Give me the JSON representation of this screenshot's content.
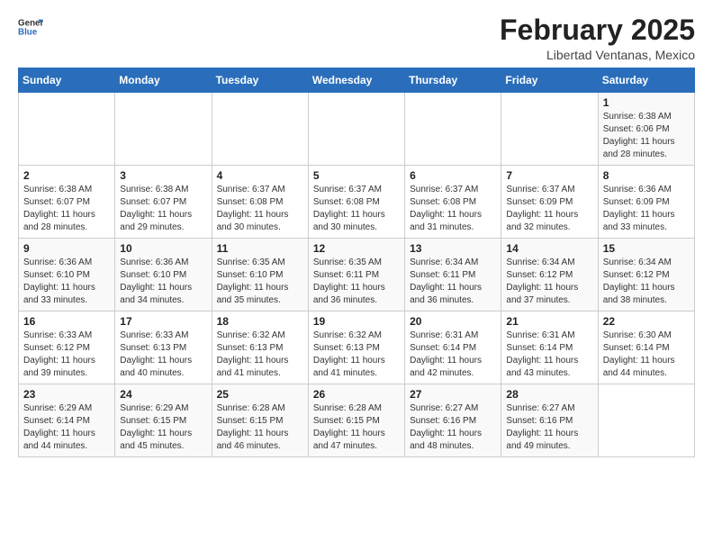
{
  "header": {
    "logo_general": "General",
    "logo_blue": "Blue",
    "month_title": "February 2025",
    "subtitle": "Libertad Ventanas, Mexico"
  },
  "days_of_week": [
    "Sunday",
    "Monday",
    "Tuesday",
    "Wednesday",
    "Thursday",
    "Friday",
    "Saturday"
  ],
  "weeks": [
    [
      {
        "day": "",
        "info": ""
      },
      {
        "day": "",
        "info": ""
      },
      {
        "day": "",
        "info": ""
      },
      {
        "day": "",
        "info": ""
      },
      {
        "day": "",
        "info": ""
      },
      {
        "day": "",
        "info": ""
      },
      {
        "day": "1",
        "info": "Sunrise: 6:38 AM\nSunset: 6:06 PM\nDaylight: 11 hours and 28 minutes."
      }
    ],
    [
      {
        "day": "2",
        "info": "Sunrise: 6:38 AM\nSunset: 6:07 PM\nDaylight: 11 hours and 28 minutes."
      },
      {
        "day": "3",
        "info": "Sunrise: 6:38 AM\nSunset: 6:07 PM\nDaylight: 11 hours and 29 minutes."
      },
      {
        "day": "4",
        "info": "Sunrise: 6:37 AM\nSunset: 6:08 PM\nDaylight: 11 hours and 30 minutes."
      },
      {
        "day": "5",
        "info": "Sunrise: 6:37 AM\nSunset: 6:08 PM\nDaylight: 11 hours and 30 minutes."
      },
      {
        "day": "6",
        "info": "Sunrise: 6:37 AM\nSunset: 6:08 PM\nDaylight: 11 hours and 31 minutes."
      },
      {
        "day": "7",
        "info": "Sunrise: 6:37 AM\nSunset: 6:09 PM\nDaylight: 11 hours and 32 minutes."
      },
      {
        "day": "8",
        "info": "Sunrise: 6:36 AM\nSunset: 6:09 PM\nDaylight: 11 hours and 33 minutes."
      }
    ],
    [
      {
        "day": "9",
        "info": "Sunrise: 6:36 AM\nSunset: 6:10 PM\nDaylight: 11 hours and 33 minutes."
      },
      {
        "day": "10",
        "info": "Sunrise: 6:36 AM\nSunset: 6:10 PM\nDaylight: 11 hours and 34 minutes."
      },
      {
        "day": "11",
        "info": "Sunrise: 6:35 AM\nSunset: 6:10 PM\nDaylight: 11 hours and 35 minutes."
      },
      {
        "day": "12",
        "info": "Sunrise: 6:35 AM\nSunset: 6:11 PM\nDaylight: 11 hours and 36 minutes."
      },
      {
        "day": "13",
        "info": "Sunrise: 6:34 AM\nSunset: 6:11 PM\nDaylight: 11 hours and 36 minutes."
      },
      {
        "day": "14",
        "info": "Sunrise: 6:34 AM\nSunset: 6:12 PM\nDaylight: 11 hours and 37 minutes."
      },
      {
        "day": "15",
        "info": "Sunrise: 6:34 AM\nSunset: 6:12 PM\nDaylight: 11 hours and 38 minutes."
      }
    ],
    [
      {
        "day": "16",
        "info": "Sunrise: 6:33 AM\nSunset: 6:12 PM\nDaylight: 11 hours and 39 minutes."
      },
      {
        "day": "17",
        "info": "Sunrise: 6:33 AM\nSunset: 6:13 PM\nDaylight: 11 hours and 40 minutes."
      },
      {
        "day": "18",
        "info": "Sunrise: 6:32 AM\nSunset: 6:13 PM\nDaylight: 11 hours and 41 minutes."
      },
      {
        "day": "19",
        "info": "Sunrise: 6:32 AM\nSunset: 6:13 PM\nDaylight: 11 hours and 41 minutes."
      },
      {
        "day": "20",
        "info": "Sunrise: 6:31 AM\nSunset: 6:14 PM\nDaylight: 11 hours and 42 minutes."
      },
      {
        "day": "21",
        "info": "Sunrise: 6:31 AM\nSunset: 6:14 PM\nDaylight: 11 hours and 43 minutes."
      },
      {
        "day": "22",
        "info": "Sunrise: 6:30 AM\nSunset: 6:14 PM\nDaylight: 11 hours and 44 minutes."
      }
    ],
    [
      {
        "day": "23",
        "info": "Sunrise: 6:29 AM\nSunset: 6:14 PM\nDaylight: 11 hours and 44 minutes."
      },
      {
        "day": "24",
        "info": "Sunrise: 6:29 AM\nSunset: 6:15 PM\nDaylight: 11 hours and 45 minutes."
      },
      {
        "day": "25",
        "info": "Sunrise: 6:28 AM\nSunset: 6:15 PM\nDaylight: 11 hours and 46 minutes."
      },
      {
        "day": "26",
        "info": "Sunrise: 6:28 AM\nSunset: 6:15 PM\nDaylight: 11 hours and 47 minutes."
      },
      {
        "day": "27",
        "info": "Sunrise: 6:27 AM\nSunset: 6:16 PM\nDaylight: 11 hours and 48 minutes."
      },
      {
        "day": "28",
        "info": "Sunrise: 6:27 AM\nSunset: 6:16 PM\nDaylight: 11 hours and 49 minutes."
      },
      {
        "day": "",
        "info": ""
      }
    ]
  ]
}
